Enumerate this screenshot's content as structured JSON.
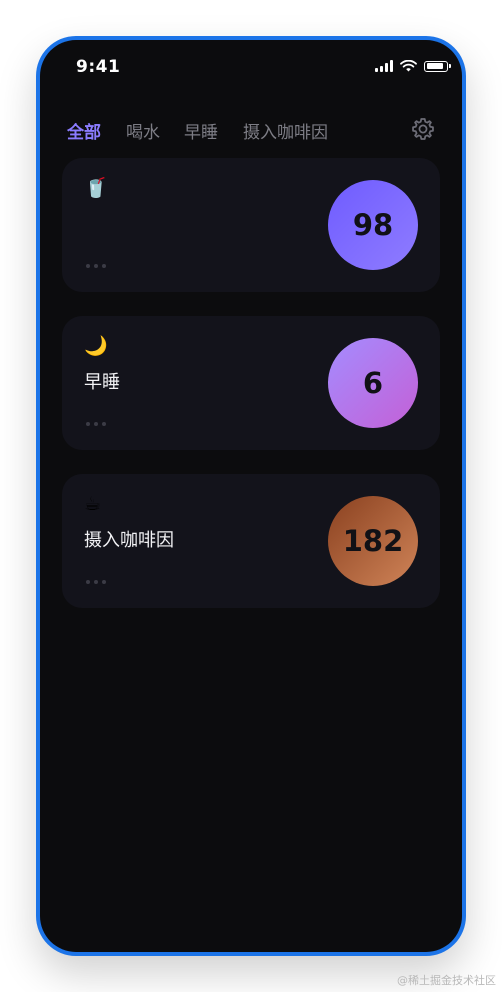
{
  "status_bar": {
    "time": "9:41",
    "battery_level": 0.9,
    "icons": [
      "cellular-signal-icon",
      "wifi-icon",
      "battery-icon"
    ]
  },
  "tabs": [
    {
      "label": "全部",
      "active": true
    },
    {
      "label": "喝水",
      "active": false
    },
    {
      "label": "早睡",
      "active": false
    },
    {
      "label": "摄入咖啡因",
      "active": false
    }
  ],
  "header": {
    "settings_icon": "gear-icon"
  },
  "cards": [
    {
      "emoji": "🥤",
      "title": "",
      "count": "98",
      "accent": "#7a67ff"
    },
    {
      "emoji": "🌙",
      "title": "早睡",
      "count": "6",
      "accent": "#b676e8"
    },
    {
      "emoji": "☕",
      "title": "摄入咖啡因",
      "count": "182",
      "accent": "#b46a42"
    }
  ],
  "colors": {
    "background": "#0c0c0e",
    "card": "#13131b",
    "active_tab": "#8b7cff",
    "inactive_tab": "#7d7d85",
    "frame": "#1c74e8"
  },
  "watermark": "@稀土掘金技术社区"
}
